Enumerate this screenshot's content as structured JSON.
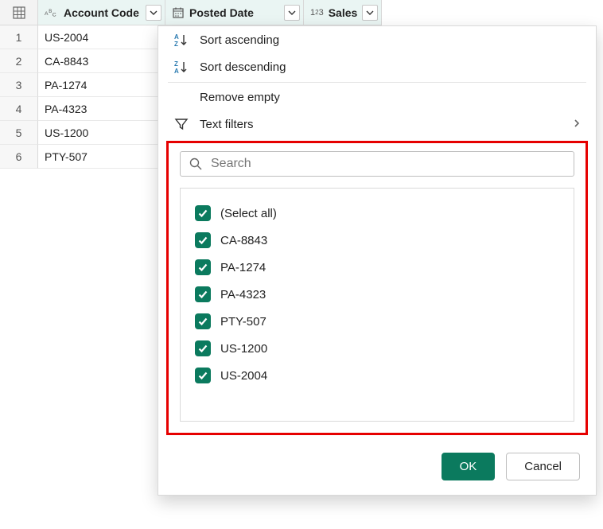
{
  "columns": [
    {
      "label": "Account Code"
    },
    {
      "label": "Posted Date"
    },
    {
      "label": "Sales"
    }
  ],
  "rows": [
    {
      "n": "1",
      "account_code": "US-2004"
    },
    {
      "n": "2",
      "account_code": "CA-8843"
    },
    {
      "n": "3",
      "account_code": "PA-1274"
    },
    {
      "n": "4",
      "account_code": "PA-4323"
    },
    {
      "n": "5",
      "account_code": "US-1200"
    },
    {
      "n": "6",
      "account_code": "PTY-507"
    }
  ],
  "dropdown": {
    "sort_asc": "Sort ascending",
    "sort_desc": "Sort descending",
    "remove_empty": "Remove empty",
    "text_filters": "Text filters",
    "search_placeholder": "Search",
    "values": [
      "(Select all)",
      "CA-8843",
      "PA-1274",
      "PA-4323",
      "PTY-507",
      "US-1200",
      "US-2004"
    ],
    "ok": "OK",
    "cancel": "Cancel"
  }
}
